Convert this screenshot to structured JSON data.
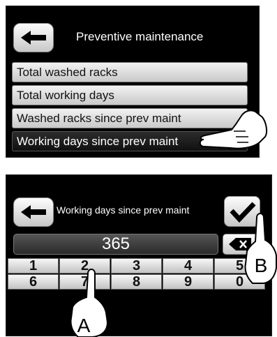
{
  "screen1": {
    "title": "Preventive maintenance",
    "menu": [
      {
        "label": "Total washed racks"
      },
      {
        "label": "Total working days"
      },
      {
        "label": "Washed racks since prev maint"
      },
      {
        "label": "Working days since prev maint"
      }
    ],
    "selected_index": 3
  },
  "screen2": {
    "title": "Working days since prev maint",
    "value": "365",
    "keys": [
      {
        "label": "1"
      },
      {
        "label": "2"
      },
      {
        "label": "3"
      },
      {
        "label": "4"
      },
      {
        "label": "5"
      },
      {
        "label": "6"
      },
      {
        "label": "7"
      },
      {
        "label": "8"
      },
      {
        "label": "9"
      },
      {
        "label": "0"
      }
    ]
  },
  "callouts": {
    "a": "A",
    "b": "B"
  },
  "icons": {
    "back": "arrow-left-icon",
    "confirm": "checkmark-icon",
    "delete": "backspace-icon",
    "pointer": "pointing-hand-icon"
  }
}
